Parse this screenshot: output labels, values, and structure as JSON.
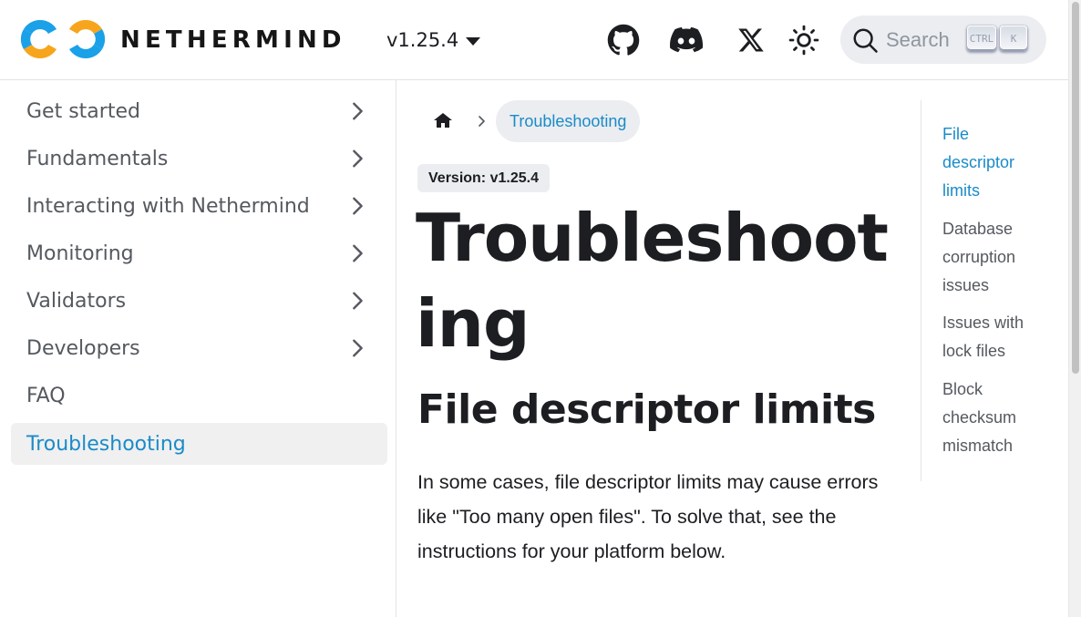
{
  "header": {
    "brand": "NETHERMIND",
    "version": "v1.25.4",
    "icons": [
      "github-icon",
      "discord-icon",
      "x-icon",
      "theme-toggle-icon"
    ],
    "search": {
      "placeholder": "Search",
      "key_ctrl": "CTRL",
      "key_k": "K"
    },
    "logo_colors": {
      "blue": "#1aa1e8",
      "orange": "#f7a51c"
    }
  },
  "sidebar": {
    "items": [
      {
        "label": "Get started",
        "expandable": true,
        "active": false
      },
      {
        "label": "Fundamentals",
        "expandable": true,
        "active": false
      },
      {
        "label": "Interacting with Nethermind",
        "expandable": true,
        "active": false
      },
      {
        "label": "Monitoring",
        "expandable": true,
        "active": false
      },
      {
        "label": "Validators",
        "expandable": true,
        "active": false
      },
      {
        "label": "Developers",
        "expandable": true,
        "active": false
      },
      {
        "label": "FAQ",
        "expandable": false,
        "active": false
      },
      {
        "label": "Troubleshooting",
        "expandable": false,
        "active": true
      }
    ]
  },
  "main": {
    "breadcrumb": {
      "current": "Troubleshooting"
    },
    "version_badge": "Version: v1.25.4",
    "title": "Troubleshooting",
    "section_heading": "File descriptor limits",
    "paragraph": "In some cases, file descriptor limits may cause errors like \"Too many open files\". To solve that, see the instructions for your platform below."
  },
  "toc": {
    "items": [
      {
        "label": "File descriptor limits",
        "active": true
      },
      {
        "label": "Database corruption issues",
        "active": false
      },
      {
        "label": "Issues with lock files",
        "active": false
      },
      {
        "label": "Block checksum mismatch",
        "active": false
      }
    ]
  },
  "colors": {
    "link": "#1a8bc8",
    "text": "#1c1e21",
    "muted": "#55595f",
    "active_bg": "#f0f0f0",
    "badge_bg": "#ebedf0"
  }
}
